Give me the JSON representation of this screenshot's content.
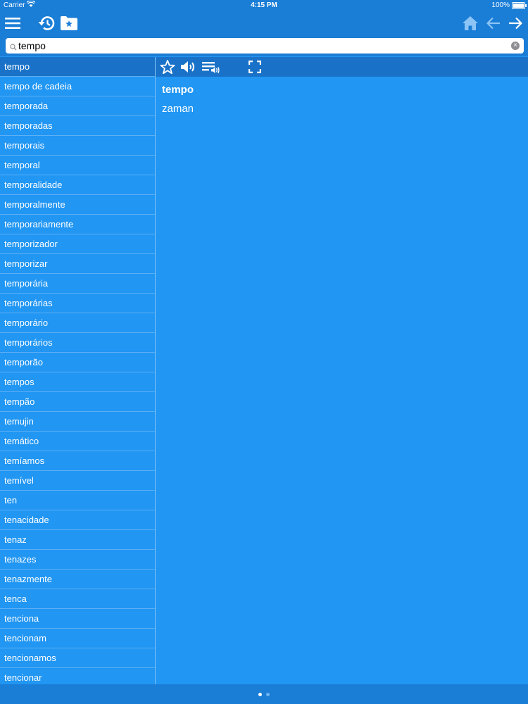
{
  "status": {
    "carrier": "Carrier",
    "time": "4:15 PM",
    "battery": "100%"
  },
  "search": {
    "value": "tempo",
    "placeholder": ""
  },
  "list": {
    "selected_index": 0,
    "items": [
      "tempo",
      "tempo de cadeia",
      "temporada",
      "temporadas",
      "temporais",
      "temporal",
      "temporalidade",
      "temporalmente",
      "temporariamente",
      "temporizador",
      "temporizar",
      "temporária",
      "temporárias",
      "temporário",
      "temporários",
      "temporão",
      "tempos",
      "tempão",
      "temujin",
      "temático",
      "temíamos",
      "temível",
      "ten",
      "tenacidade",
      "tenaz",
      "tenazes",
      "tenazmente",
      "tenca",
      "tenciona",
      "tencionam",
      "tencionamos",
      "tencionar"
    ]
  },
  "entry": {
    "word": "tempo",
    "translation": "zaman"
  },
  "colors": {
    "background": "#2196f3",
    "bar": "#1a7dd6",
    "selected": "#1a72c8"
  },
  "icons": {
    "menu": "hamburger-icon",
    "history": "history-icon",
    "favorites_folder": "star-folder-icon",
    "home": "home-icon",
    "back": "arrow-left-icon",
    "forward": "arrow-right-icon",
    "favorite": "star-outline-icon",
    "speak": "speaker-icon",
    "speak_list": "playlist-audio-icon",
    "fullscreen": "fullscreen-icon"
  },
  "pager": {
    "pages": 2,
    "current": 1
  }
}
